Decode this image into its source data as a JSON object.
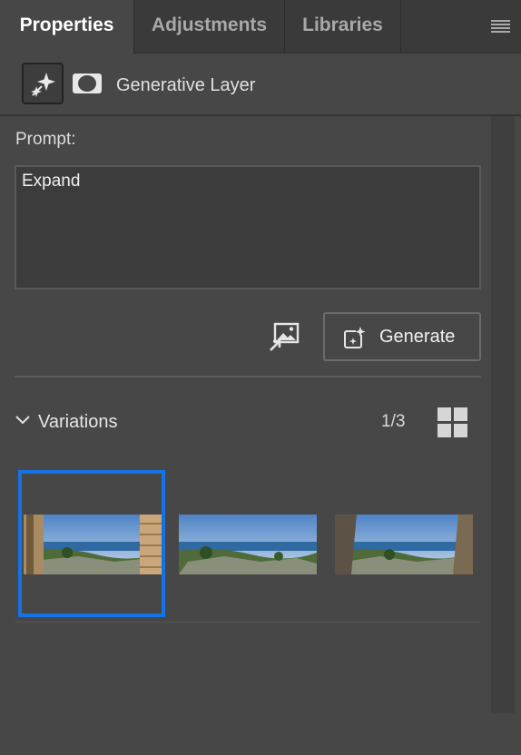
{
  "tabs": [
    {
      "label": "Properties",
      "active": true
    },
    {
      "label": "Adjustments",
      "active": false
    },
    {
      "label": "Libraries",
      "active": false
    }
  ],
  "icons": {
    "menu": "hamburger-menu-icon",
    "generative": "generative-sparkle-icon",
    "mask": "layer-mask-icon",
    "reference_image": "reference-image-icon",
    "generate": "generate-sparkle-icon",
    "chevron": "chevron-down-icon",
    "grid": "grid-view-icon"
  },
  "layer": {
    "title": "Generative Layer"
  },
  "prompt": {
    "label": "Prompt:",
    "value": "Expand"
  },
  "generate": {
    "label": "Generate"
  },
  "variations": {
    "label": "Variations",
    "count": "1/3",
    "items": [
      {
        "selected": true
      },
      {
        "selected": false
      },
      {
        "selected": false
      }
    ]
  },
  "colors": {
    "panel_bg": "#474747",
    "tabbar_bg": "#3a3a3a",
    "selection": "#1473e6"
  }
}
